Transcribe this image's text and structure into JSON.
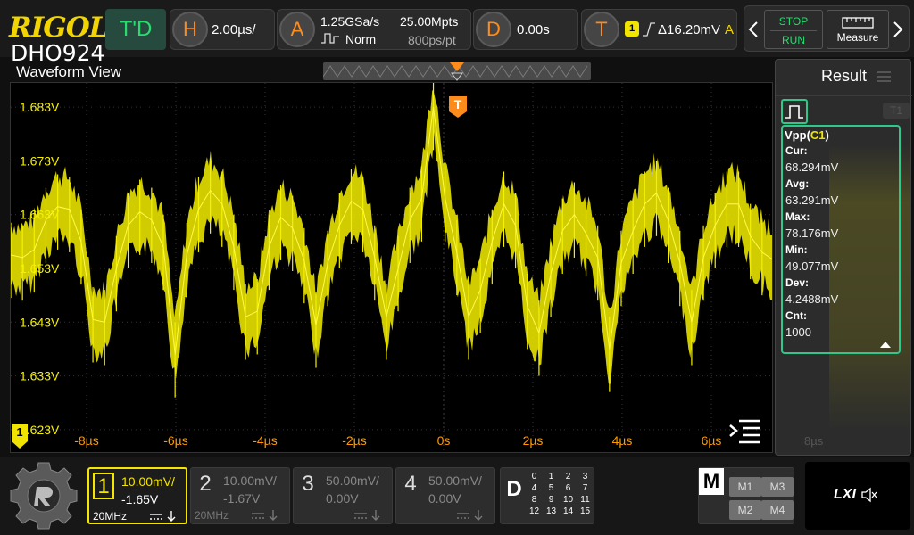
{
  "brand": {
    "logo": "RIGOL",
    "model": "DHO924"
  },
  "header": {
    "trigger_mode": "T'D",
    "horizontal": {
      "badge": "H",
      "value": "2.00µs/"
    },
    "acquire": {
      "badge": "A",
      "rate": "1.25GSa/s",
      "mode": "Norm",
      "points": "25.00Mpts",
      "resolution": "800ps/pt"
    },
    "delay": {
      "badge": "D",
      "value": "0.00s"
    },
    "trigger": {
      "badge": "T",
      "channel": "1",
      "level": "Δ16.20mV",
      "type": "A"
    },
    "stop_label": "STOP",
    "run_label": "RUN",
    "measure_label": "Measure"
  },
  "waveform_view": {
    "title": "Waveform View",
    "trigger_marker": "T",
    "channel_marker": "1",
    "y_ticks": [
      "1.683V",
      "1.673V",
      "1.663V",
      "1.653V",
      "1.643V",
      "1.633V",
      "1.623V"
    ],
    "x_ticks": [
      "-8µs",
      "-6µs",
      "-4µs",
      "-2µs",
      "0s",
      "2µs",
      "4µs",
      "6µs"
    ],
    "ghost_tick": "8µs",
    "colors": {
      "trace": "#f5f000",
      "time": "#ff9a00",
      "grid": "#333333"
    }
  },
  "chart_data": {
    "type": "line",
    "title": "",
    "xlabel": "",
    "ylabel": "",
    "x_unit": "µs",
    "y_unit": "V",
    "xlim": [
      -9.7,
      7.4
    ],
    "ylim": [
      1.6185,
      1.6875
    ],
    "grid": true,
    "legend": "none",
    "series": [
      {
        "values": [
          1.6555,
          1.655,
          1.6565,
          1.662,
          1.6645,
          1.664,
          1.658,
          1.6435,
          1.643,
          1.653,
          1.661,
          1.6635,
          1.662,
          1.657,
          1.637,
          1.6555,
          1.664,
          1.6675,
          1.665,
          1.657,
          1.644,
          1.645,
          1.657,
          1.6625,
          1.6605,
          1.6545,
          1.6425,
          1.654,
          1.661,
          1.6655,
          1.664,
          1.655,
          1.644,
          1.653,
          1.662,
          1.666,
          1.683,
          1.666,
          1.656,
          1.644,
          1.649,
          1.658,
          1.665,
          1.661,
          1.646,
          1.641,
          1.652,
          1.66,
          1.663,
          1.6595,
          1.655,
          1.638,
          1.654,
          1.66,
          1.665,
          1.667,
          1.662,
          1.654,
          1.643,
          1.655,
          1.661,
          1.665,
          1.665,
          1.659,
          1.656,
          1.6545
        ]
      }
    ]
  },
  "result": {
    "title": "Result",
    "ghost_channel": "T1",
    "measurement": "Vpp",
    "source": "C1",
    "stats": [
      {
        "label": "Cur:",
        "value": "68.294mV"
      },
      {
        "label": "Avg:",
        "value": "63.291mV"
      },
      {
        "label": "Max:",
        "value": "78.176mV"
      },
      {
        "label": "Min:",
        "value": "49.077mV"
      },
      {
        "label": "Dev:",
        "value": "4.2488mV"
      },
      {
        "label": "Cnt:",
        "value": "1000"
      }
    ]
  },
  "channels": [
    {
      "num": "1",
      "scale": "10.00mV/",
      "offset": "-1.65V",
      "bw": "20MHz",
      "coupling": "DC",
      "active": true,
      "color": "#f5e600"
    },
    {
      "num": "2",
      "scale": "10.00mV/",
      "offset": "-1.67V",
      "bw": "20MHz",
      "coupling": "DC",
      "active": false,
      "color": "#777777"
    },
    {
      "num": "3",
      "scale": "50.00mV/",
      "offset": "0.00V",
      "bw": "",
      "coupling": "DC",
      "active": false,
      "color": "#777777"
    },
    {
      "num": "4",
      "scale": "50.00mV/",
      "offset": "0.00V",
      "bw": "",
      "coupling": "DC",
      "active": false,
      "color": "#777777"
    }
  ],
  "digital": {
    "label": "D",
    "grid": [
      [
        "0",
        "1",
        "2",
        "3"
      ],
      [
        "4",
        "5",
        "6",
        "7"
      ],
      [
        "8",
        "9",
        "10",
        "11"
      ],
      [
        "12",
        "13",
        "14",
        "15"
      ]
    ]
  },
  "math": {
    "label": "M",
    "buttons": [
      "M1",
      "M3",
      "M2",
      "M4"
    ]
  },
  "lxi": {
    "label": "LXI"
  }
}
